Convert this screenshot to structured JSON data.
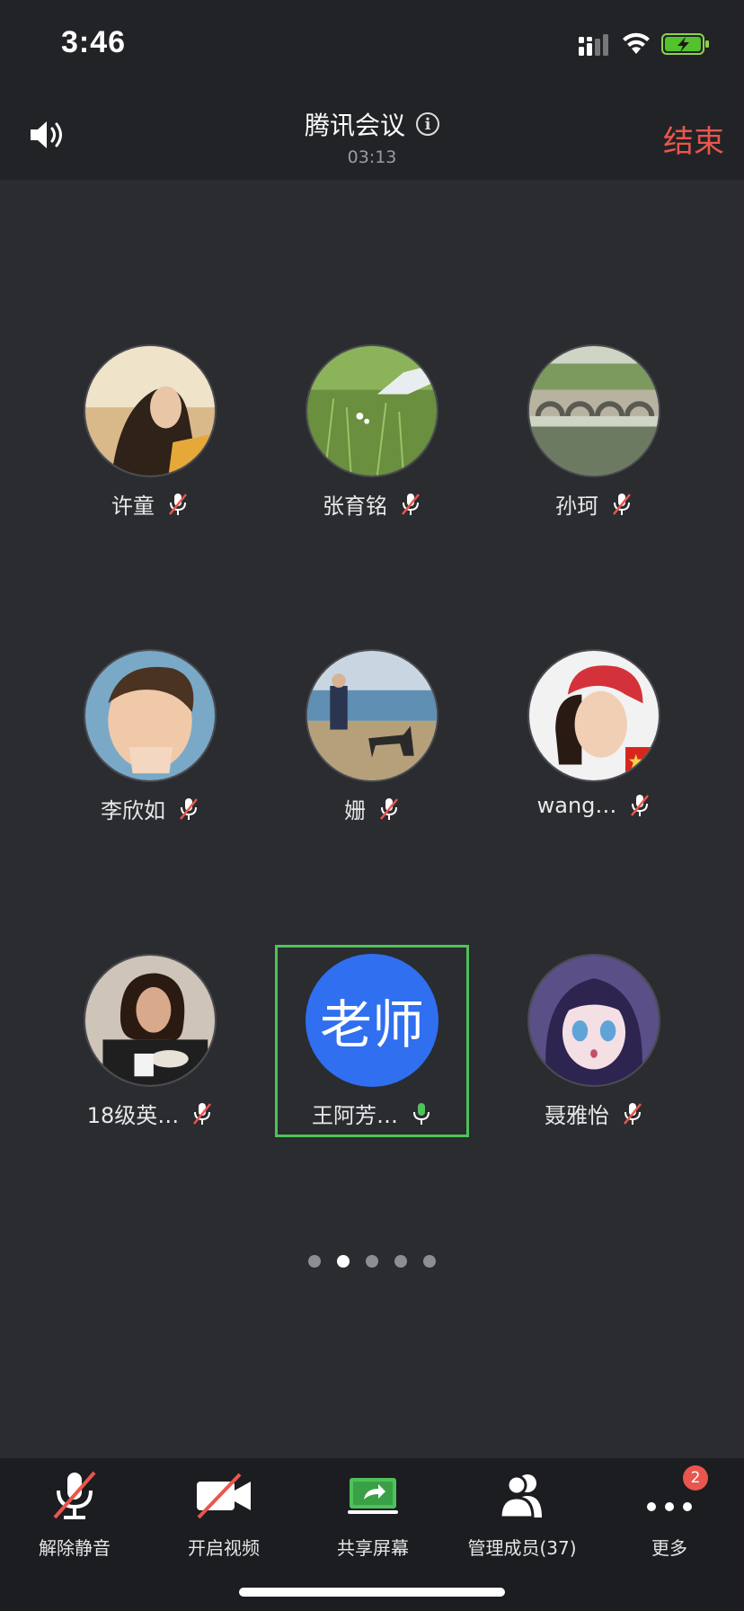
{
  "status_bar": {
    "time": "3:46",
    "icons": [
      "signal-icon",
      "wifi-icon",
      "battery-charging-icon"
    ]
  },
  "header": {
    "title": "腾讯会议",
    "duration": "03:13",
    "end_label": "结束",
    "icons": [
      "speaker-icon",
      "info-icon"
    ]
  },
  "participants": [
    {
      "name": "许童",
      "muted": true
    },
    {
      "name": "张育铭",
      "muted": true
    },
    {
      "name": "孙珂",
      "muted": true
    },
    {
      "name": "李欣如",
      "muted": true
    },
    {
      "name": "姗",
      "muted": true
    },
    {
      "name": "wang…",
      "muted": true
    },
    {
      "name": "18级英…",
      "muted": true
    },
    {
      "name": "王阿芳…",
      "muted": false,
      "avatar_text": "老师",
      "speaking": true
    },
    {
      "name": "聂雅怡",
      "muted": true
    }
  ],
  "pagination": {
    "pages": 5,
    "current": 2
  },
  "toolbar": {
    "unmute": "解除静音",
    "video": "开启视频",
    "share": "共享屏幕",
    "members": "管理成员(37)",
    "more": "更多",
    "more_badge": "2"
  },
  "colors": {
    "accent_end": "#e8564d",
    "speaking_frame": "#4ec25a",
    "teacher_avatar": "#2f6ff0",
    "share_icon": "#4ec25a"
  }
}
